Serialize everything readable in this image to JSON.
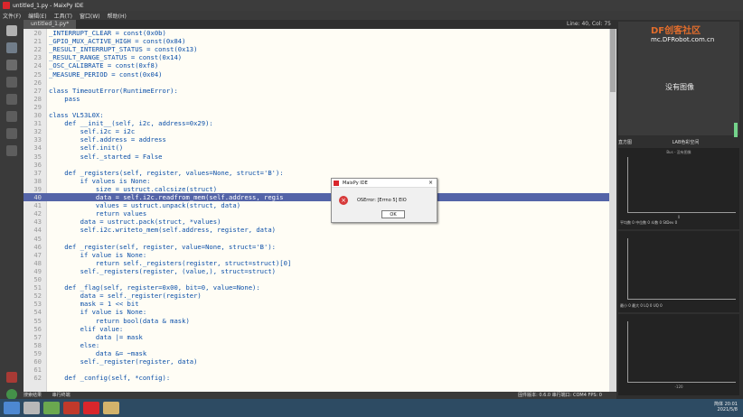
{
  "window": {
    "title": "untitled_1.py - MaixPy IDE"
  },
  "menu": [
    "文件(F)",
    "编辑(E)",
    "工具(T)",
    "窗口(W)",
    "帮助(H)"
  ],
  "tab": {
    "label": "untitled_1.py*"
  },
  "editor": {
    "position": "Line: 40, Col: 75"
  },
  "watermark": {
    "brand": "DF创客社区",
    "url": "mc.DFRobot.com.cn"
  },
  "framebuffer": {
    "empty_text": "没有图像"
  },
  "histogram": {
    "header_left": "直方图",
    "header_right": "LAB色彩空间",
    "plot_title": "Bus - 没有图像",
    "axis_ticks": [
      "0",
      "15",
      "30",
      "45",
      "60",
      "75",
      "90"
    ],
    "axis_ticks2": [
      "-120",
      "-80",
      "-40",
      "0",
      "40",
      "80",
      "120"
    ],
    "stats_labels": [
      "平均数",
      "中位数",
      "众数",
      "StDev",
      "最小",
      "最大",
      "LQ",
      "UQ"
    ],
    "stats_values": [
      "0",
      "0",
      "0",
      "0",
      "0",
      "0",
      "0",
      "0"
    ]
  },
  "status": {
    "left": [
      "搜索结果",
      "串行终端"
    ],
    "right": "固件版本: 0.6.0  串行端口: COM4  FPS: 0"
  },
  "dialog": {
    "title": "MaixPy IDE",
    "message": "OSError: [Errno 5] EIO",
    "ok": "OK"
  },
  "taskbar": {
    "time": "20:01",
    "date": "2021/5/8",
    "lang": "简体"
  },
  "code": [
    {
      "n": "20",
      "t": "_INTERRUPT_CLEAR = const(0x0b)"
    },
    {
      "n": "21",
      "t": "_GPIO_MUX_ACTIVE_HIGH = const(0x84)"
    },
    {
      "n": "22",
      "t": "_RESULT_INTERRUPT_STATUS = const(0x13)"
    },
    {
      "n": "23",
      "t": "_RESULT_RANGE_STATUS = const(0x14)"
    },
    {
      "n": "24",
      "t": "_OSC_CALIBRATE = const(0xf8)"
    },
    {
      "n": "25",
      "t": "_MEASURE_PERIOD = const(0x04)"
    },
    {
      "n": "26",
      "t": ""
    },
    {
      "n": "27",
      "t": "class TimeoutError(RuntimeError):"
    },
    {
      "n": "28",
      "t": "    pass"
    },
    {
      "n": "29",
      "t": ""
    },
    {
      "n": "30",
      "t": "class VL53L0X:"
    },
    {
      "n": "31",
      "t": "    def __init__(self, i2c, address=0x29):"
    },
    {
      "n": "32",
      "t": "        self.i2c = i2c"
    },
    {
      "n": "33",
      "t": "        self.address = address"
    },
    {
      "n": "34",
      "t": "        self.init()"
    },
    {
      "n": "35",
      "t": "        self._started = False"
    },
    {
      "n": "36",
      "t": ""
    },
    {
      "n": "37",
      "t": "    def _registers(self, register, values=None, struct='B'):"
    },
    {
      "n": "38",
      "t": "        if values is None:"
    },
    {
      "n": "39",
      "t": "            size = ustruct.calcsize(struct)"
    },
    {
      "n": "40",
      "t": "            data = self.i2c.readfrom_mem(self.address, regis"
    },
    {
      "n": "41",
      "t": "            values = ustruct.unpack(struct, data)"
    },
    {
      "n": "42",
      "t": "            return values"
    },
    {
      "n": "43",
      "t": "        data = ustruct.pack(struct, *values)"
    },
    {
      "n": "44",
      "t": "        self.i2c.writeto_mem(self.address, register, data)"
    },
    {
      "n": "45",
      "t": ""
    },
    {
      "n": "46",
      "t": "    def _register(self, register, value=None, struct='B'):"
    },
    {
      "n": "47",
      "t": "        if value is None:"
    },
    {
      "n": "48",
      "t": "            return self._registers(register, struct=struct)[0]"
    },
    {
      "n": "49",
      "t": "        self._registers(register, (value,), struct=struct)"
    },
    {
      "n": "50",
      "t": ""
    },
    {
      "n": "51",
      "t": "    def _flag(self, register=0x00, bit=0, value=None):"
    },
    {
      "n": "52",
      "t": "        data = self._register(register)"
    },
    {
      "n": "53",
      "t": "        mask = 1 << bit"
    },
    {
      "n": "54",
      "t": "        if value is None:"
    },
    {
      "n": "55",
      "t": "            return bool(data & mask)"
    },
    {
      "n": "56",
      "t": "        elif value:"
    },
    {
      "n": "57",
      "t": "            data |= mask"
    },
    {
      "n": "58",
      "t": "        else:"
    },
    {
      "n": "59",
      "t": "            data &= ~mask"
    },
    {
      "n": "60",
      "t": "        self._register(register, data)"
    },
    {
      "n": "61",
      "t": ""
    },
    {
      "n": "62",
      "t": "    def _config(self, *config):"
    }
  ],
  "colors": {
    "accent": "#d9262c",
    "highlight": "#5464a8",
    "code": "#0b4fa8"
  }
}
